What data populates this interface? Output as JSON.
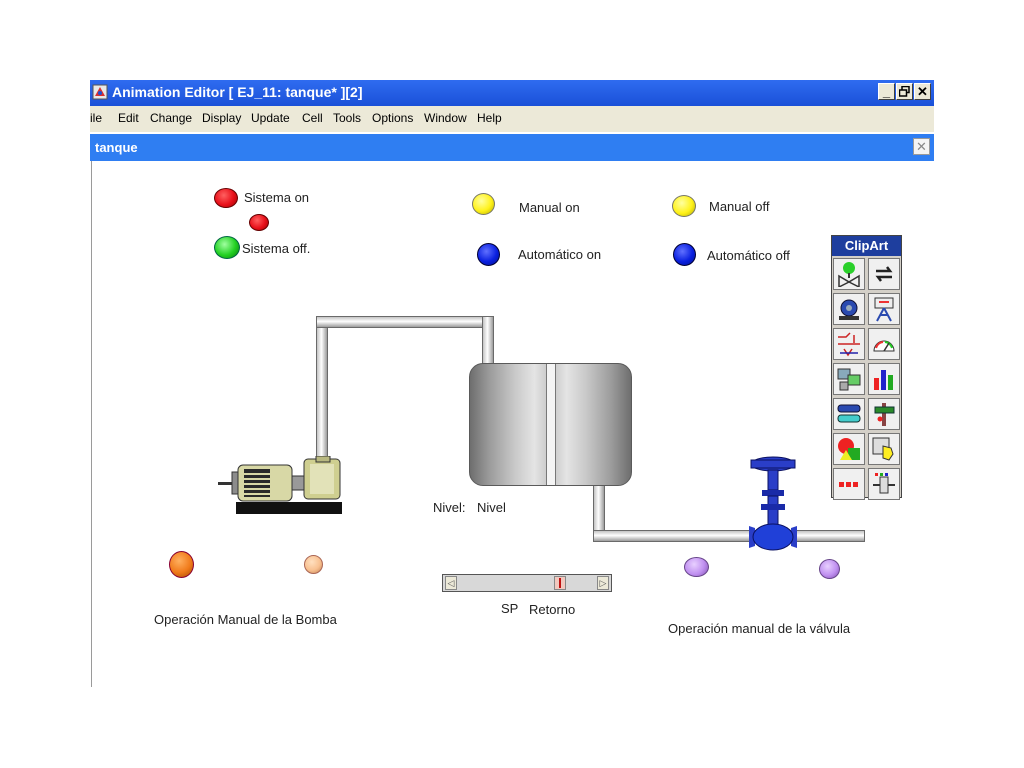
{
  "window": {
    "title": "Animation Editor [ EJ_11: tanque* ][2]",
    "minimize": "_",
    "restore": "🗗",
    "close": "✕"
  },
  "menu": [
    "ile",
    "Edit",
    "Change",
    "Display",
    "Update",
    "Cell",
    "Tools",
    "Options",
    "Window",
    "Help"
  ],
  "child_window": {
    "title": "tanque",
    "close": "✕"
  },
  "indicators": {
    "sistema_on": "Sistema on",
    "sistema_off": "Sistema off.",
    "manual_on": "Manual on",
    "manual_off": "Manual off",
    "automatico_on": "Automático on",
    "automatico_off": "Automático off"
  },
  "labels": {
    "nivel_prefix": "Nivel:",
    "nivel_value": "Nivel",
    "sp": "SP",
    "retorno": "Retorno",
    "bomba": "Operación Manual de la Bomba",
    "valvula": "Operación manual de la válvula"
  },
  "slider": {
    "left_arrow": "◁",
    "right_arrow": "▷"
  },
  "clipart": {
    "title": "ClipArt",
    "icons": [
      "valve-icon",
      "refresh-icon",
      "pump-icon",
      "equipment-icon",
      "circuit-icon",
      "gauge-icon",
      "panel-icon",
      "bar-chart-icon",
      "tank-level-icon",
      "sign-icon",
      "shapes-icon",
      "hand-pointer-icon",
      "dots-icon",
      "slider-control-icon"
    ]
  },
  "colors": {
    "titlebar": "#1a50d8",
    "childbar": "#2f7ef2",
    "led_red": "#e8101a",
    "led_green": "#22d022",
    "led_yellow": "#fff21a",
    "led_blue": "#0a20e0",
    "led_orange": "#f07a1a",
    "led_peach": "#f8c090",
    "led_purple": "#c090f0"
  }
}
